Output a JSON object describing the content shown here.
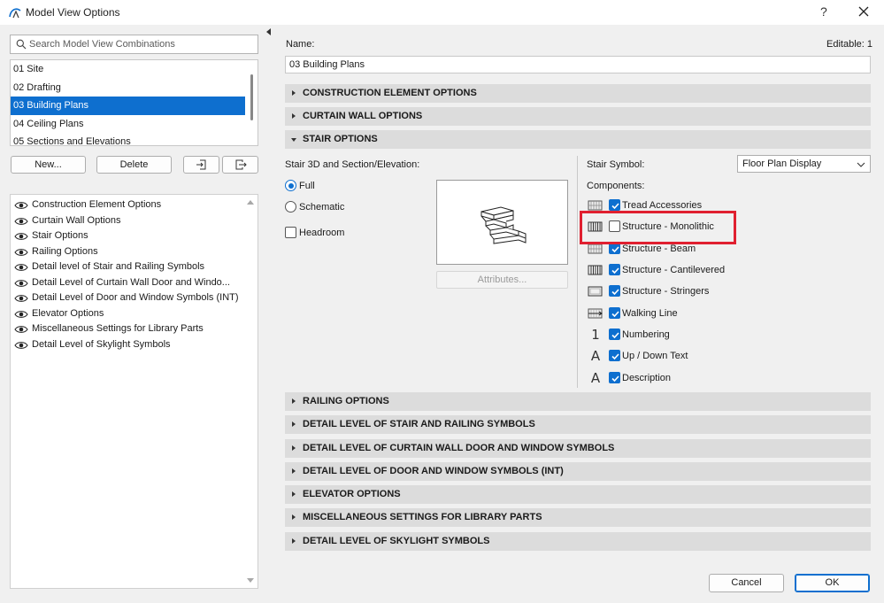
{
  "window": {
    "title": "Model View Options",
    "help": "?"
  },
  "search": {
    "placeholder": "Search Model View Combinations"
  },
  "combinations": [
    {
      "label": "01 Site",
      "selected": false
    },
    {
      "label": "02 Drafting",
      "selected": false
    },
    {
      "label": "03 Building Plans",
      "selected": true
    },
    {
      "label": "04 Ceiling Plans",
      "selected": false
    },
    {
      "label": "05 Sections and Elevations",
      "selected": false
    }
  ],
  "buttons": {
    "new": "New...",
    "delete": "Delete",
    "cancel": "Cancel",
    "ok": "OK",
    "attributes": "Attributes..."
  },
  "option_sets": [
    "Construction Element Options",
    "Curtain Wall Options",
    "Stair Options",
    "Railing Options",
    "Detail level of Stair and Railing Symbols",
    "Detail Level of Curtain Wall Door and Windo...",
    "Detail Level of Door and Window Symbols (INT)",
    "Elevator Options",
    "Miscellaneous Settings for Library Parts",
    "Detail Level of Skylight Symbols"
  ],
  "name": {
    "label": "Name:",
    "value": "03 Building Plans",
    "editable": "Editable: 1"
  },
  "sections_top": [
    "CONSTRUCTION ELEMENT OPTIONS",
    "CURTAIN WALL OPTIONS",
    "STAIR OPTIONS"
  ],
  "stair": {
    "section_3d_label": "Stair 3D and Section/Elevation:",
    "full": "Full",
    "schematic": "Schematic",
    "headroom": "Headroom",
    "symbol_label": "Stair Symbol:",
    "symbol_value": "Floor Plan Display",
    "components_label": "Components:",
    "components": [
      {
        "label": "Tread Accessories",
        "checked": true,
        "icon": "grid-icon"
      },
      {
        "label": "Structure - Monolithic",
        "checked": false,
        "icon": "vertical-lines-icon"
      },
      {
        "label": "Structure - Beam",
        "checked": true,
        "icon": "grid-icon"
      },
      {
        "label": "Structure - Cantilevered",
        "checked": true,
        "icon": "vertical-lines-icon"
      },
      {
        "label": "Structure - Stringers",
        "checked": true,
        "icon": "frame-icon"
      },
      {
        "label": "Walking Line",
        "checked": true,
        "icon": "walking-line-icon"
      },
      {
        "label": "Numbering",
        "checked": true,
        "icon": "numbering-icon"
      },
      {
        "label": "Up / Down Text",
        "checked": true,
        "icon": "text-icon"
      },
      {
        "label": "Description",
        "checked": true,
        "icon": "text-icon"
      }
    ],
    "numbering_glyph": "1",
    "text_glyph": "A"
  },
  "sections_bottom": [
    "RAILING OPTIONS",
    "DETAIL LEVEL OF STAIR AND RAILING SYMBOLS",
    "DETAIL LEVEL OF CURTAIN WALL DOOR AND WINDOW SYMBOLS",
    "DETAIL LEVEL OF DOOR AND WINDOW SYMBOLS (INT)",
    "ELEVATOR OPTIONS",
    "MISCELLANEOUS SETTINGS FOR LIBRARY PARTS",
    "DETAIL LEVEL OF SKYLIGHT SYMBOLS"
  ],
  "colors": {
    "accent": "#0e6fcf",
    "highlight": "#e02030"
  }
}
